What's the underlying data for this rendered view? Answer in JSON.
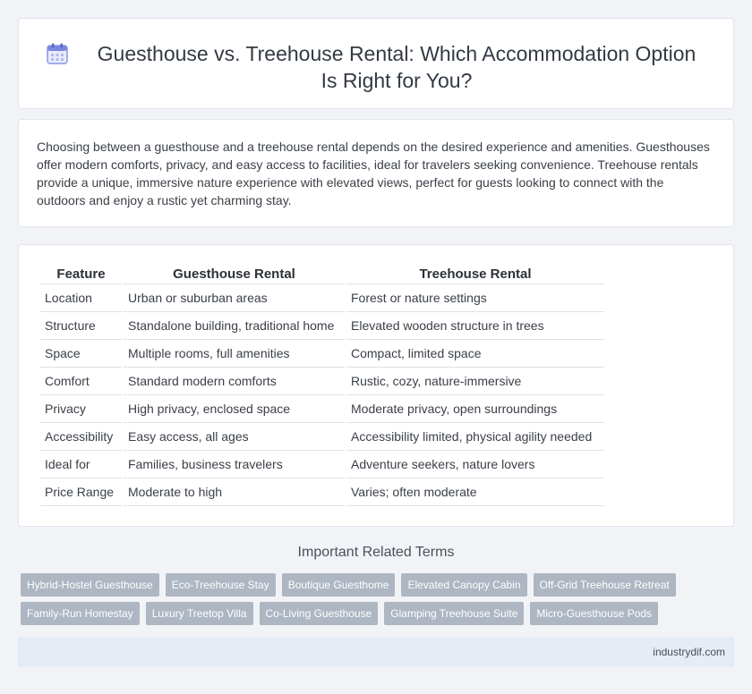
{
  "header": {
    "icon": "calendar-icon",
    "title": "Guesthouse vs. Treehouse Rental: Which Accommodation Option Is Right for You?"
  },
  "intro": {
    "text": "Choosing between a guesthouse and a treehouse rental depends on the desired experience and amenities. Guesthouses offer modern comforts, privacy, and easy access to facilities, ideal for travelers seeking convenience. Treehouse rentals provide a unique, immersive nature experience with elevated views, perfect for guests looking to connect with the outdoors and enjoy a rustic yet charming stay."
  },
  "table": {
    "headers": [
      "Feature",
      "Guesthouse Rental",
      "Treehouse Rental"
    ],
    "rows": [
      [
        "Location",
        "Urban or suburban areas",
        "Forest or nature settings"
      ],
      [
        "Structure",
        "Standalone building, traditional home",
        "Elevated wooden structure in trees"
      ],
      [
        "Space",
        "Multiple rooms, full amenities",
        "Compact, limited space"
      ],
      [
        "Comfort",
        "Standard modern comforts",
        "Rustic, cozy, nature-immersive"
      ],
      [
        "Privacy",
        "High privacy, enclosed space",
        "Moderate privacy, open surroundings"
      ],
      [
        "Accessibility",
        "Easy access, all ages",
        "Accessibility limited, physical agility needed"
      ],
      [
        "Ideal for",
        "Families, business travelers",
        "Adventure seekers, nature lovers"
      ],
      [
        "Price Range",
        "Moderate to high",
        "Varies; often moderate"
      ]
    ]
  },
  "related": {
    "title": "Important Related Terms",
    "tags": [
      "Hybrid-Hostel Guesthouse",
      "Eco-Treehouse Stay",
      "Boutique Guesthome",
      "Elevated Canopy Cabin",
      "Off-Grid Treehouse Retreat",
      "Family-Run Homestay",
      "Luxury Treetop Villa",
      "Co-Living Guesthouse",
      "Glamping Treehouse Suite",
      "Micro-Guesthouse Pods"
    ]
  },
  "footer": {
    "site": "industrydif.com"
  },
  "colors": {
    "background": "#f1f3f7",
    "tag_background": "#aeb6c2",
    "footer_background": "#e6ecf5",
    "icon_accent": "#7b86e0"
  }
}
